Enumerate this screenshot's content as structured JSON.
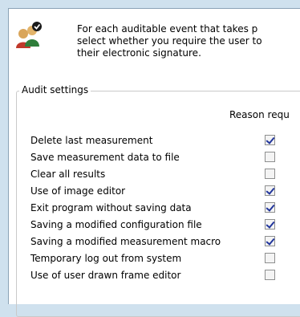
{
  "intro": {
    "text": "For each auditable event that takes p\nselect whether you require the user to\ntheir electronic signature."
  },
  "icons": {
    "header": "users-check-icon"
  },
  "audit": {
    "group_label": "Audit settings",
    "column_header": "Reason requ",
    "items": [
      {
        "label": "Delete last measurement",
        "checked": true
      },
      {
        "label": "Save measurement data to file",
        "checked": false
      },
      {
        "label": "Clear all results",
        "checked": false
      },
      {
        "label": "Use of image editor",
        "checked": true
      },
      {
        "label": "Exit program without saving data",
        "checked": true
      },
      {
        "label": "Saving a modified configuration file",
        "checked": true
      },
      {
        "label": "Saving a modified measurement macro",
        "checked": true
      },
      {
        "label": "Temporary log out from system",
        "checked": false
      },
      {
        "label": "Use of user drawn frame editor",
        "checked": false
      }
    ]
  },
  "colors": {
    "background": "#cfe1ee",
    "check": "#21359b"
  }
}
